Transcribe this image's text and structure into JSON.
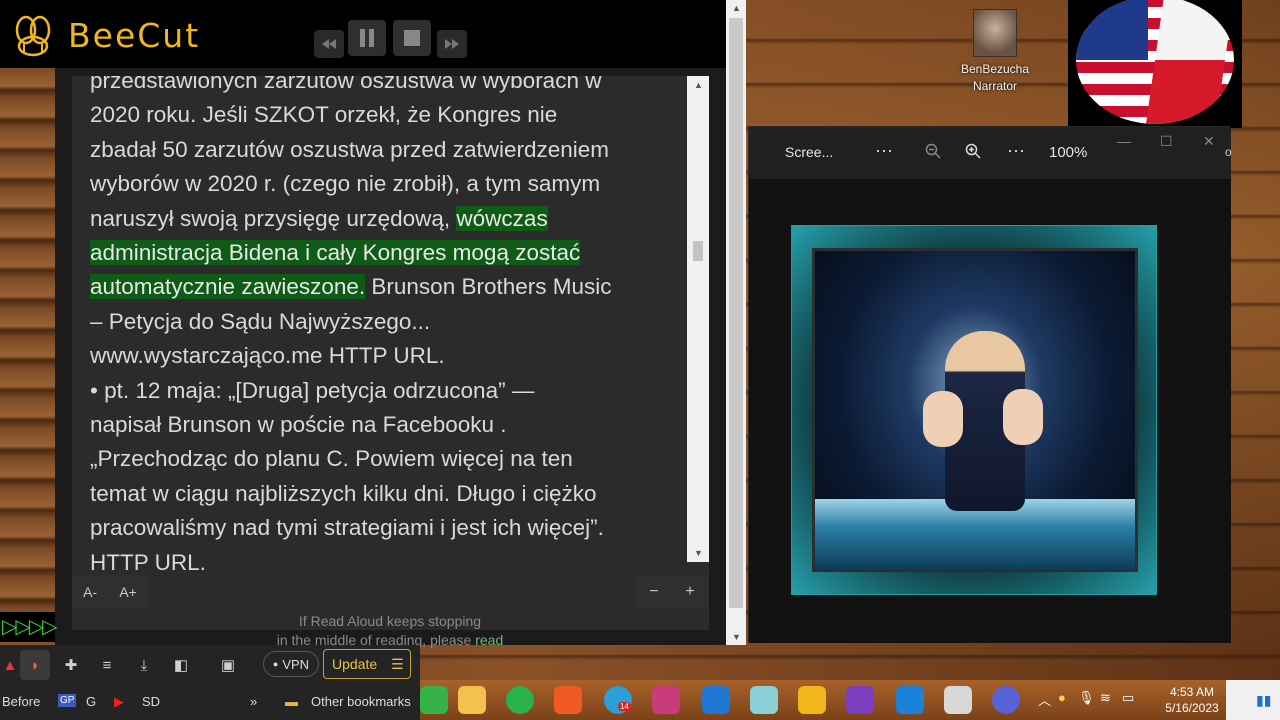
{
  "beecut": {
    "title": "BeeCut",
    "controls": [
      "rewind",
      "pause",
      "stop",
      "fast-forward"
    ]
  },
  "reader": {
    "lines": [
      {
        "text": "przedstawionych zarzutów oszustwa w wyborach w"
      },
      {
        "text": "2020 roku. Jeśli SZKOT orzekł, że Kongres nie"
      },
      {
        "text": "zbadał 50 zarzutów oszustwa przed zatwierdzeniem"
      },
      {
        "text": "wyborów w 2020 r. (czego nie zrobił), a tym samym"
      },
      {
        "pre": "naruszył swoją przysięgę urzędową, ",
        "hl": "wówczas"
      },
      {
        "hl": "administracja Bidena i cały Kongres mogą zostać"
      },
      {
        "hl": "automatycznie zawieszone.",
        "post": " Brunson Brothers Music"
      },
      {
        "text": "– Petycja do Sądu Najwyższego..."
      },
      {
        "text": "www.wystarczająco.me HTTP URL."
      },
      {
        "text": "• pt. 12 maja: „[Druga] petycja odrzucona” —"
      },
      {
        "text": "napisał Brunson w poście na Facebooku ."
      },
      {
        "text": "„Przechodząc do planu C. Powiem więcej na ten"
      },
      {
        "text": "temat w ciągu najbliższych kilku dni. Długo i ciężko"
      },
      {
        "text": "pracowaliśmy nad tymi strategiami i jest ich więcej”."
      },
      {
        "text": "HTTP URL."
      }
    ],
    "font_decrease": "A-",
    "font_increase": "A+",
    "zoom_out": "−",
    "zoom_in": "+",
    "hint_line1": "If Read Aloud keeps stopping",
    "hint_line2": "in the middle of reading, please",
    "hint_link": "read",
    "highlight_color": "#0f5c16"
  },
  "narrator": {
    "name": "BenBezucha",
    "role": "Narrator"
  },
  "photos": {
    "title": "Scree...",
    "more1": "···",
    "more2": "···",
    "zoom": "100%",
    "min": "—",
    "max": "☐",
    "close": "✕",
    "side_letter": "o"
  },
  "browser": {
    "vpn_label": "VPN",
    "update_label": "Update",
    "bookmarks": [
      "Before",
      "G",
      "SD"
    ],
    "bookmarks_more": "»",
    "other_bookmarks": "Other bookmarks",
    "gp_label": "GP"
  },
  "taskbar": {
    "time": "4:53 AM",
    "date": "5/16/2023",
    "telegram_badge": "14"
  }
}
